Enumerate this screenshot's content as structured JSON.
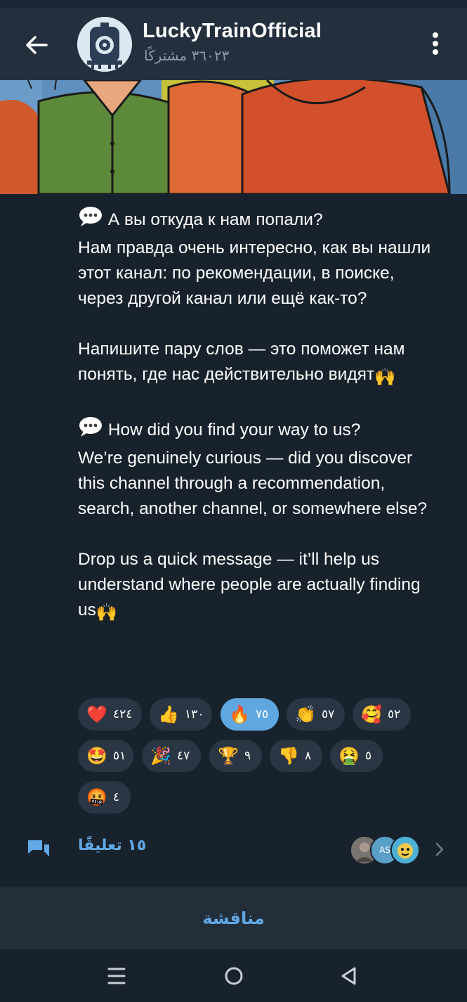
{
  "header": {
    "title": "LuckyTrainOfficial",
    "subtitle": "٣٦٠٢٣ مشتركًا",
    "icons": [
      "back-arrow-icon",
      "channel-avatar",
      "more-vertical-icon"
    ]
  },
  "message": {
    "paragraphs": [
      "А вы откуда к нам попали?",
      "Нам правда очень интересно, как вы нашли этот канал: по рекомендации, в поиске, через другой канал или ещё как-то?",
      "Напишите пару слов — это поможет нам понять, где нас действительно видят",
      "How did you find your way to us?",
      "We’re genuinely curious — did you discover this channel through a recommendation, search, another channel, or somewhere else?",
      "Drop us a quick message — it’ll help us understand where people are actually finding us"
    ]
  },
  "reactions": [
    {
      "emoji": "❤️",
      "count": "٤٢٤",
      "icon": "heart-icon",
      "active": false
    },
    {
      "emoji": "👍",
      "count": "١٣٠",
      "icon": "thumbs-up-icon",
      "active": false
    },
    {
      "emoji": "🔥",
      "count": "٧٥",
      "icon": "fire-icon",
      "active": true
    },
    {
      "emoji": "👏",
      "count": "٥٧",
      "icon": "clap-icon",
      "active": false
    },
    {
      "emoji": "🥰",
      "count": "٥٢",
      "icon": "smiling-hearts-icon",
      "active": false
    },
    {
      "emoji": "🤩",
      "count": "٥١",
      "icon": "star-struck-icon",
      "active": false
    },
    {
      "emoji": "🎉",
      "count": "٤٧",
      "icon": "party-popper-icon",
      "active": false
    },
    {
      "emoji": "🏆",
      "count": "٩",
      "icon": "trophy-icon",
      "active": false
    },
    {
      "emoji": "👎",
      "count": "٨",
      "icon": "thumbs-down-icon",
      "active": false
    },
    {
      "emoji": "🤮",
      "count": "٥",
      "icon": "vomiting-face-icon",
      "active": false
    },
    {
      "emoji": "🤬",
      "count": "٤",
      "icon": "cursing-face-icon",
      "active": false
    }
  ],
  "comments": {
    "label": "١٥ تعليقًا",
    "avatar_initials": "AS"
  },
  "discussion_button": "مناقشة",
  "colors": {
    "background": "#18222d",
    "header": "#242f3d",
    "accent": "#61a9e6",
    "reaction_bg": "#2a3644",
    "reaction_active": "#5ea7e0"
  }
}
